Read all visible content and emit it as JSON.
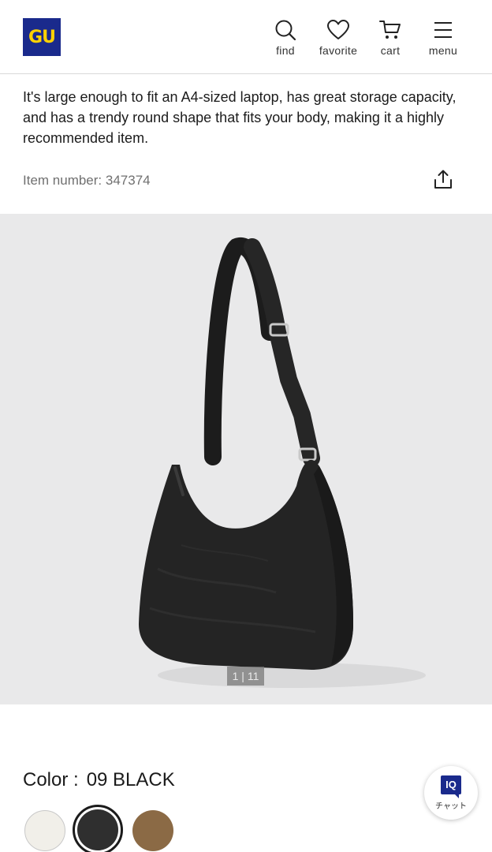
{
  "header": {
    "logo_text": "GU",
    "nav": [
      {
        "label": "find",
        "icon": "search-icon"
      },
      {
        "label": "favorite",
        "icon": "heart-icon"
      },
      {
        "label": "cart",
        "icon": "cart-icon"
      },
      {
        "label": "menu",
        "icon": "hamburger-menu-icon"
      }
    ]
  },
  "product": {
    "description": "It's large enough to fit an A4-sized laptop, has great storage capacity, and has a trendy round shape that fits your body, making it a highly recommended item.",
    "item_number": "Item number: 347374",
    "share_icon": "share-icon"
  },
  "gallery": {
    "counter": "1 | 11",
    "image_subject": "black-shoulder-bag"
  },
  "color": {
    "label": "Color :",
    "value": "09 BLACK",
    "swatches": [
      {
        "name": "off-white",
        "color": "#f1efe9",
        "selected": false
      },
      {
        "name": "black",
        "color": "#2f2f2f",
        "selected": true
      },
      {
        "name": "brown",
        "color": "#8b6a45",
        "selected": false
      }
    ]
  },
  "chat": {
    "badge": "IQ",
    "label": "チャット"
  },
  "colors": {
    "brand_blue": "#1a2a8c",
    "brand_yellow": "#ffd200"
  }
}
